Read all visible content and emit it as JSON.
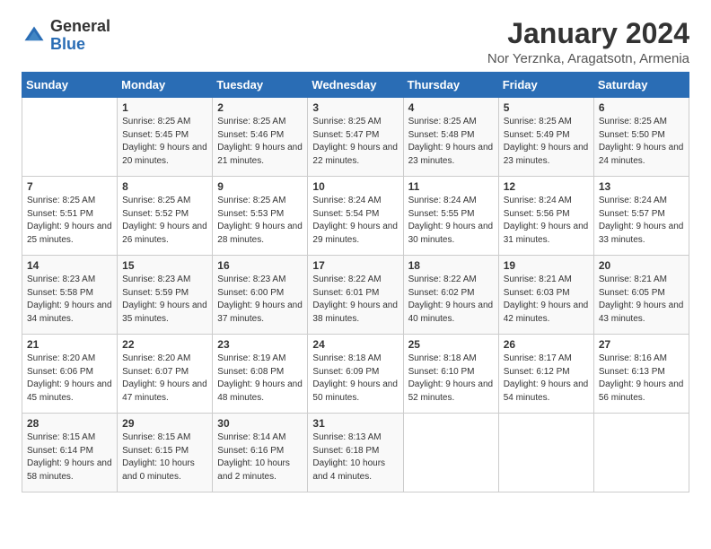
{
  "logo": {
    "general": "General",
    "blue": "Blue"
  },
  "title": "January 2024",
  "subtitle": "Nor Yerznka, Aragatsotn, Armenia",
  "headers": [
    "Sunday",
    "Monday",
    "Tuesday",
    "Wednesday",
    "Thursday",
    "Friday",
    "Saturday"
  ],
  "weeks": [
    [
      {
        "day": "",
        "sunrise": "",
        "sunset": "",
        "daylight": ""
      },
      {
        "day": "1",
        "sunrise": "Sunrise: 8:25 AM",
        "sunset": "Sunset: 5:45 PM",
        "daylight": "Daylight: 9 hours and 20 minutes."
      },
      {
        "day": "2",
        "sunrise": "Sunrise: 8:25 AM",
        "sunset": "Sunset: 5:46 PM",
        "daylight": "Daylight: 9 hours and 21 minutes."
      },
      {
        "day": "3",
        "sunrise": "Sunrise: 8:25 AM",
        "sunset": "Sunset: 5:47 PM",
        "daylight": "Daylight: 9 hours and 22 minutes."
      },
      {
        "day": "4",
        "sunrise": "Sunrise: 8:25 AM",
        "sunset": "Sunset: 5:48 PM",
        "daylight": "Daylight: 9 hours and 23 minutes."
      },
      {
        "day": "5",
        "sunrise": "Sunrise: 8:25 AM",
        "sunset": "Sunset: 5:49 PM",
        "daylight": "Daylight: 9 hours and 23 minutes."
      },
      {
        "day": "6",
        "sunrise": "Sunrise: 8:25 AM",
        "sunset": "Sunset: 5:50 PM",
        "daylight": "Daylight: 9 hours and 24 minutes."
      }
    ],
    [
      {
        "day": "7",
        "sunrise": "Sunrise: 8:25 AM",
        "sunset": "Sunset: 5:51 PM",
        "daylight": "Daylight: 9 hours and 25 minutes."
      },
      {
        "day": "8",
        "sunrise": "Sunrise: 8:25 AM",
        "sunset": "Sunset: 5:52 PM",
        "daylight": "Daylight: 9 hours and 26 minutes."
      },
      {
        "day": "9",
        "sunrise": "Sunrise: 8:25 AM",
        "sunset": "Sunset: 5:53 PM",
        "daylight": "Daylight: 9 hours and 28 minutes."
      },
      {
        "day": "10",
        "sunrise": "Sunrise: 8:24 AM",
        "sunset": "Sunset: 5:54 PM",
        "daylight": "Daylight: 9 hours and 29 minutes."
      },
      {
        "day": "11",
        "sunrise": "Sunrise: 8:24 AM",
        "sunset": "Sunset: 5:55 PM",
        "daylight": "Daylight: 9 hours and 30 minutes."
      },
      {
        "day": "12",
        "sunrise": "Sunrise: 8:24 AM",
        "sunset": "Sunset: 5:56 PM",
        "daylight": "Daylight: 9 hours and 31 minutes."
      },
      {
        "day": "13",
        "sunrise": "Sunrise: 8:24 AM",
        "sunset": "Sunset: 5:57 PM",
        "daylight": "Daylight: 9 hours and 33 minutes."
      }
    ],
    [
      {
        "day": "14",
        "sunrise": "Sunrise: 8:23 AM",
        "sunset": "Sunset: 5:58 PM",
        "daylight": "Daylight: 9 hours and 34 minutes."
      },
      {
        "day": "15",
        "sunrise": "Sunrise: 8:23 AM",
        "sunset": "Sunset: 5:59 PM",
        "daylight": "Daylight: 9 hours and 35 minutes."
      },
      {
        "day": "16",
        "sunrise": "Sunrise: 8:23 AM",
        "sunset": "Sunset: 6:00 PM",
        "daylight": "Daylight: 9 hours and 37 minutes."
      },
      {
        "day": "17",
        "sunrise": "Sunrise: 8:22 AM",
        "sunset": "Sunset: 6:01 PM",
        "daylight": "Daylight: 9 hours and 38 minutes."
      },
      {
        "day": "18",
        "sunrise": "Sunrise: 8:22 AM",
        "sunset": "Sunset: 6:02 PM",
        "daylight": "Daylight: 9 hours and 40 minutes."
      },
      {
        "day": "19",
        "sunrise": "Sunrise: 8:21 AM",
        "sunset": "Sunset: 6:03 PM",
        "daylight": "Daylight: 9 hours and 42 minutes."
      },
      {
        "day": "20",
        "sunrise": "Sunrise: 8:21 AM",
        "sunset": "Sunset: 6:05 PM",
        "daylight": "Daylight: 9 hours and 43 minutes."
      }
    ],
    [
      {
        "day": "21",
        "sunrise": "Sunrise: 8:20 AM",
        "sunset": "Sunset: 6:06 PM",
        "daylight": "Daylight: 9 hours and 45 minutes."
      },
      {
        "day": "22",
        "sunrise": "Sunrise: 8:20 AM",
        "sunset": "Sunset: 6:07 PM",
        "daylight": "Daylight: 9 hours and 47 minutes."
      },
      {
        "day": "23",
        "sunrise": "Sunrise: 8:19 AM",
        "sunset": "Sunset: 6:08 PM",
        "daylight": "Daylight: 9 hours and 48 minutes."
      },
      {
        "day": "24",
        "sunrise": "Sunrise: 8:18 AM",
        "sunset": "Sunset: 6:09 PM",
        "daylight": "Daylight: 9 hours and 50 minutes."
      },
      {
        "day": "25",
        "sunrise": "Sunrise: 8:18 AM",
        "sunset": "Sunset: 6:10 PM",
        "daylight": "Daylight: 9 hours and 52 minutes."
      },
      {
        "day": "26",
        "sunrise": "Sunrise: 8:17 AM",
        "sunset": "Sunset: 6:12 PM",
        "daylight": "Daylight: 9 hours and 54 minutes."
      },
      {
        "day": "27",
        "sunrise": "Sunrise: 8:16 AM",
        "sunset": "Sunset: 6:13 PM",
        "daylight": "Daylight: 9 hours and 56 minutes."
      }
    ],
    [
      {
        "day": "28",
        "sunrise": "Sunrise: 8:15 AM",
        "sunset": "Sunset: 6:14 PM",
        "daylight": "Daylight: 9 hours and 58 minutes."
      },
      {
        "day": "29",
        "sunrise": "Sunrise: 8:15 AM",
        "sunset": "Sunset: 6:15 PM",
        "daylight": "Daylight: 10 hours and 0 minutes."
      },
      {
        "day": "30",
        "sunrise": "Sunrise: 8:14 AM",
        "sunset": "Sunset: 6:16 PM",
        "daylight": "Daylight: 10 hours and 2 minutes."
      },
      {
        "day": "31",
        "sunrise": "Sunrise: 8:13 AM",
        "sunset": "Sunset: 6:18 PM",
        "daylight": "Daylight: 10 hours and 4 minutes."
      },
      {
        "day": "",
        "sunrise": "",
        "sunset": "",
        "daylight": ""
      },
      {
        "day": "",
        "sunrise": "",
        "sunset": "",
        "daylight": ""
      },
      {
        "day": "",
        "sunrise": "",
        "sunset": "",
        "daylight": ""
      }
    ]
  ]
}
